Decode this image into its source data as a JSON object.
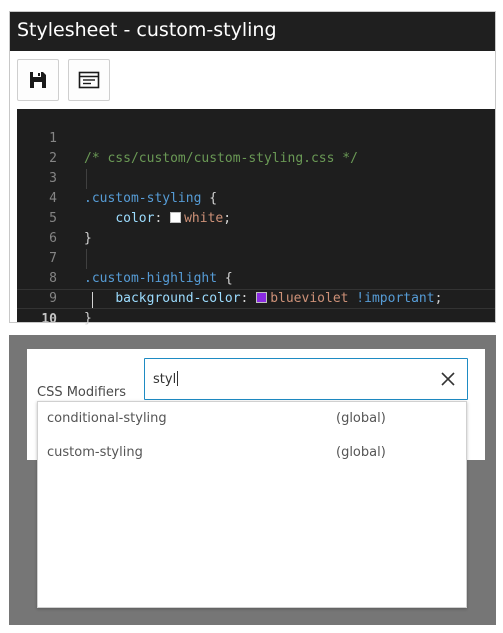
{
  "editor": {
    "title": "Stylesheet - custom-styling",
    "toolbar": {
      "save_icon": "floppy-disk-icon",
      "snippet_icon": "snippet-icon"
    },
    "current_line": "10",
    "lines": [
      {
        "num": "1",
        "comment": "/* css/custom/custom-styling.css */"
      },
      {
        "num": "2"
      },
      {
        "num": "3",
        "selector": ".custom-styling",
        "brace": " {"
      },
      {
        "num": "4",
        "indent": "    ",
        "prop": "color",
        "colon": ": ",
        "swatch": "#ffffff",
        "value": "white",
        "end": ";"
      },
      {
        "num": "5",
        "brace": "}"
      },
      {
        "num": "6"
      },
      {
        "num": "7",
        "selector": ".custom-highlight",
        "brace": " {"
      },
      {
        "num": "8",
        "indent": "    ",
        "prop": "background-color",
        "colon": ": ",
        "swatch": "#8a2be2",
        "value": "blueviolet",
        "important": " !important",
        "end": ";"
      },
      {
        "num": "9",
        "brace": "}"
      },
      {
        "num": "10"
      }
    ]
  },
  "modifiers": {
    "label": "CSS Modifiers",
    "search_value": "styl",
    "accent_color": "#1e8bc3",
    "suggestions": [
      {
        "name": "conditional-styling",
        "scope": "(global)"
      },
      {
        "name": "custom-styling",
        "scope": "(global)"
      }
    ]
  }
}
